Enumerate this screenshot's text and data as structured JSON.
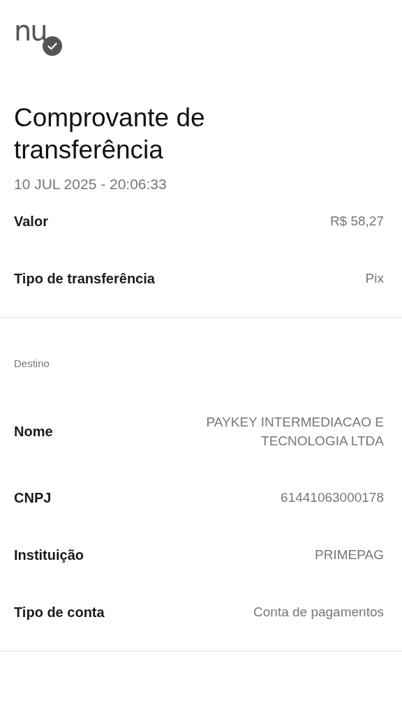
{
  "logo": {
    "text": "nu",
    "verified": true
  },
  "title": "Comprovante de transferência",
  "datetime": "10 JUL 2025 - 20:06:33",
  "sections": [
    {
      "rows": [
        {
          "label": "Valor",
          "value": "R$ 58,27"
        },
        {
          "label": "Tipo de transferência",
          "value": "Pix"
        }
      ]
    },
    {
      "heading": "Destino",
      "rows": [
        {
          "label": "Nome",
          "value": "PAYKEY INTERMEDIACAO E TECNOLOGIA LTDA"
        },
        {
          "label": "CNPJ",
          "value": "61441063000178"
        },
        {
          "label": "Instituição",
          "value": "PRIMEPAG"
        },
        {
          "label": "Tipo de conta",
          "value": "Conta de pagamentos"
        }
      ]
    }
  ]
}
